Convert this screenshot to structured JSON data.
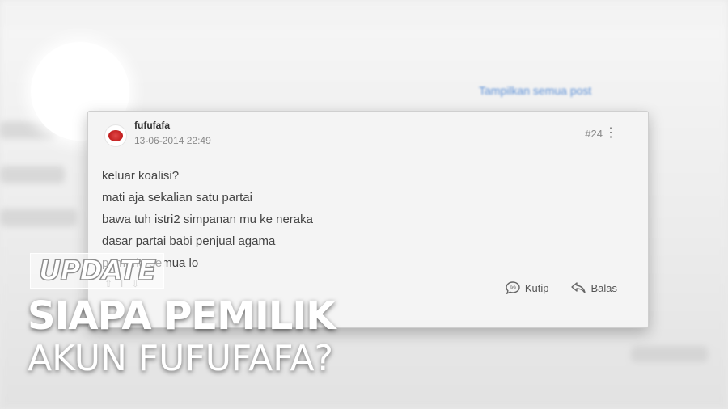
{
  "header": {
    "show_all_link": "Tampilkan semua post"
  },
  "post": {
    "username": "fufufafa",
    "date": "13-06-2014 22:49",
    "number": "#24",
    "lines": [
      "keluar koalisi?",
      "mati aja sekalian satu partai",
      "bawa tuh istri2 simpanan mu ke neraka",
      "dasar partai babi penjual agama",
      "pemuria semua lo"
    ],
    "quote_label": "Kutip",
    "reply_label": "Balas"
  },
  "overlay": {
    "tag": "UPDATE",
    "headline_line1": "SIAPA PEMILIK",
    "headline_line2": "AKUN FUFUFAFA?"
  }
}
